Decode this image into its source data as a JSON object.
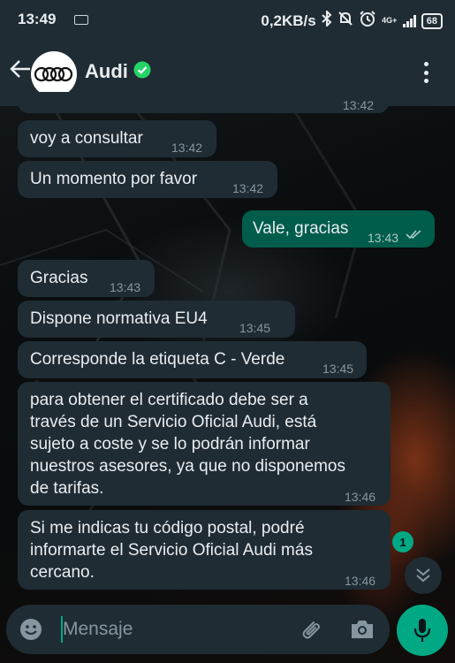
{
  "status_bar": {
    "time": "13:49",
    "net_speed": "0,2KB/s",
    "network": "4G+",
    "battery": "68"
  },
  "chat": {
    "contact_name": "Audi",
    "icons": {
      "back": "arrow-left-icon",
      "verified": "verified-badge-icon",
      "menu": "more-vertical-icon"
    }
  },
  "messages": [
    {
      "direction": "in",
      "text": "voy a consultar",
      "time": "13:42"
    },
    {
      "direction": "in",
      "text": "Un momento por favor",
      "time": "13:42"
    },
    {
      "direction": "out",
      "text": "Vale, gracias",
      "time": "13:43",
      "status": "read"
    },
    {
      "direction": "in",
      "text": "Gracias",
      "time": "13:43"
    },
    {
      "direction": "in",
      "text": "Dispone normativa EU4",
      "time": "13:45"
    },
    {
      "direction": "in",
      "text": "Corresponde la etiqueta C - Verde",
      "time": "13:45"
    },
    {
      "direction": "in",
      "lines": [
        "para obtener el certificado debe ser a",
        "través de un Servicio Oficial Audi, está",
        "sujeto a coste y se lo podrán informar",
        "nuestros asesores, ya que no disponemos",
        "de tarifas."
      ],
      "time": "13:46"
    },
    {
      "direction": "in",
      "lines": [
        "Si me indicas tu código postal, podré",
        "informarte el Servicio Oficial Audi más",
        "cercano."
      ],
      "time": "13:46"
    }
  ],
  "partial_top_time": "13:42",
  "unread_count": "1",
  "composer": {
    "placeholder": "Mensaje"
  },
  "colors": {
    "app_bar": "#1f2c34",
    "incoming_bubble": "#1f2c34",
    "outgoing_bubble": "#005c4b",
    "accent": "#00a884"
  }
}
